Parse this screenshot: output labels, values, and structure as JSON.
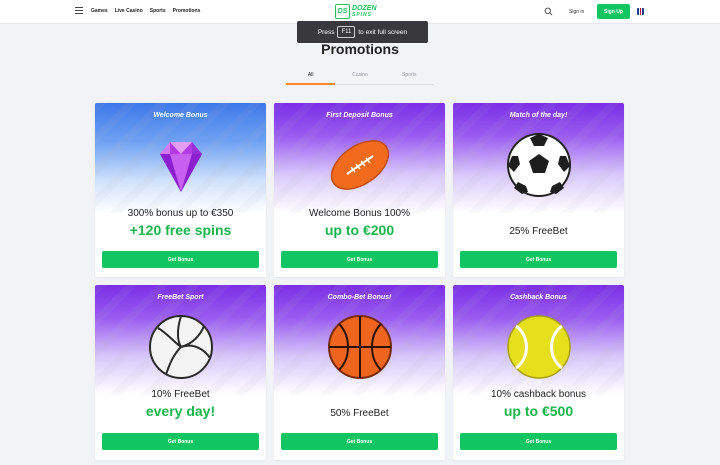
{
  "header": {
    "nav": [
      "Games",
      "Live Casino",
      "Sports",
      "Promotions"
    ],
    "logo_mark": "DS",
    "logo_line1": "DOZEN",
    "logo_line2": "SPINS",
    "signin_label": "Sign in",
    "signup_label": "Sign Up"
  },
  "toast": {
    "before": "Press",
    "key": "F11",
    "after": "to exit full screen"
  },
  "page_title": "Promotions",
  "tabs": [
    "All",
    "Casino",
    "Sports"
  ],
  "active_tab": "All",
  "cards": [
    {
      "title": "Welcome Bonus",
      "line1": "300% bonus up to €350",
      "line2": "+120 free spins",
      "button": "Get Bonus",
      "art": "diamond-icon",
      "theme": "blue"
    },
    {
      "title": "First Deposit Bonus",
      "line1": "Welcome Bonus 100%",
      "line2": "up to €200",
      "button": "Get Bonus",
      "art": "football-icon",
      "theme": "purple"
    },
    {
      "title": "Match of the day!",
      "line1": "25% FreeBet",
      "line2": "",
      "button": "Get Bonus",
      "art": "soccer-ball-icon",
      "theme": "purple"
    },
    {
      "title": "FreeBet Sport",
      "line1": "10% FreeBet",
      "line2": "every day!",
      "button": "Get Bonus",
      "art": "volleyball-icon",
      "theme": "purple"
    },
    {
      "title": "Combo-Bet Bonus!",
      "line1": "50% FreeBet",
      "line2": "",
      "button": "Get Bonus",
      "art": "basketball-icon",
      "theme": "purple"
    },
    {
      "title": "Cashback Bonus",
      "line1": "10% cashback bonus",
      "line2": "up to €500",
      "button": "Get Bonus",
      "art": "tennis-ball-icon",
      "theme": "purple"
    }
  ],
  "colors": {
    "brand_green": "#10c562",
    "accent_orange": "#ff8a2a",
    "highlight_green": "#18b44c",
    "card_purple": "#7a2fe6",
    "card_blue": "#3e78e8"
  }
}
